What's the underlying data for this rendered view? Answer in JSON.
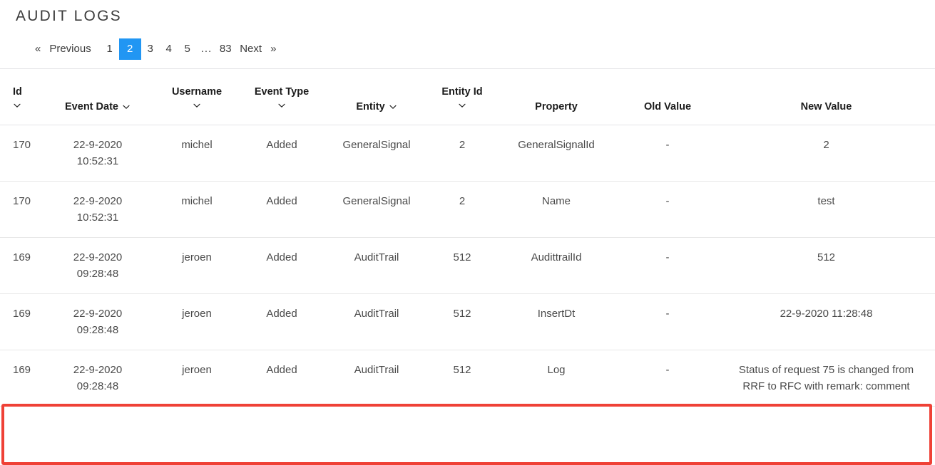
{
  "page_title": "AUDIT LOGS",
  "pagination": {
    "prev_chevron": "«",
    "prev_label": "Previous",
    "next_label": "Next",
    "next_chevron": "»",
    "pages": [
      "1",
      "2",
      "3",
      "4",
      "5"
    ],
    "gap": "...",
    "last_page": "83",
    "active_page": "2",
    "active_color": "#2196f3"
  },
  "table": {
    "columns": [
      {
        "label": "Id",
        "sortable": true,
        "wrap": "below"
      },
      {
        "label": "Event Date",
        "sortable": true,
        "wrap": "inline"
      },
      {
        "label": "Username",
        "sortable": true,
        "wrap": "below"
      },
      {
        "label": "Event Type",
        "sortable": true,
        "wrap": "below"
      },
      {
        "label": "Entity",
        "sortable": true,
        "wrap": "inline"
      },
      {
        "label": "Entity Id",
        "sortable": true,
        "wrap": "below"
      },
      {
        "label": "Property",
        "sortable": false,
        "wrap": "none"
      },
      {
        "label": "Old Value",
        "sortable": false,
        "wrap": "none"
      },
      {
        "label": "New Value",
        "sortable": false,
        "wrap": "none"
      }
    ],
    "rows": [
      {
        "id": "170",
        "event_date_line1": "22-9-2020",
        "event_date_line2": "10:52:31",
        "username": "michel",
        "event_type": "Added",
        "entity": "GeneralSignal",
        "entity_id": "2",
        "property": "GeneralSignalId",
        "old_value": "-",
        "new_value_line1": "2",
        "new_value_line2": "",
        "highlighted": false
      },
      {
        "id": "170",
        "event_date_line1": "22-9-2020",
        "event_date_line2": "10:52:31",
        "username": "michel",
        "event_type": "Added",
        "entity": "GeneralSignal",
        "entity_id": "2",
        "property": "Name",
        "old_value": "-",
        "new_value_line1": "test",
        "new_value_line2": "",
        "highlighted": false
      },
      {
        "id": "169",
        "event_date_line1": "22-9-2020",
        "event_date_line2": "09:28:48",
        "username": "jeroen",
        "event_type": "Added",
        "entity": "AuditTrail",
        "entity_id": "512",
        "property": "AudittrailId",
        "old_value": "-",
        "new_value_line1": "512",
        "new_value_line2": "",
        "highlighted": false
      },
      {
        "id": "169",
        "event_date_line1": "22-9-2020",
        "event_date_line2": "09:28:48",
        "username": "jeroen",
        "event_type": "Added",
        "entity": "AuditTrail",
        "entity_id": "512",
        "property": "InsertDt",
        "old_value": "-",
        "new_value_line1": "22-9-2020 11:28:48",
        "new_value_line2": "",
        "highlighted": false
      },
      {
        "id": "169",
        "event_date_line1": "22-9-2020",
        "event_date_line2": "09:28:48",
        "username": "jeroen",
        "event_type": "Added",
        "entity": "AuditTrail",
        "entity_id": "512",
        "property": "Log",
        "old_value": "-",
        "new_value_line1": "Status of request 75 is changed from",
        "new_value_line2": "RRF to RFC with remark: comment",
        "highlighted": true
      }
    ]
  },
  "highlight": {
    "color": "#ef4136"
  }
}
